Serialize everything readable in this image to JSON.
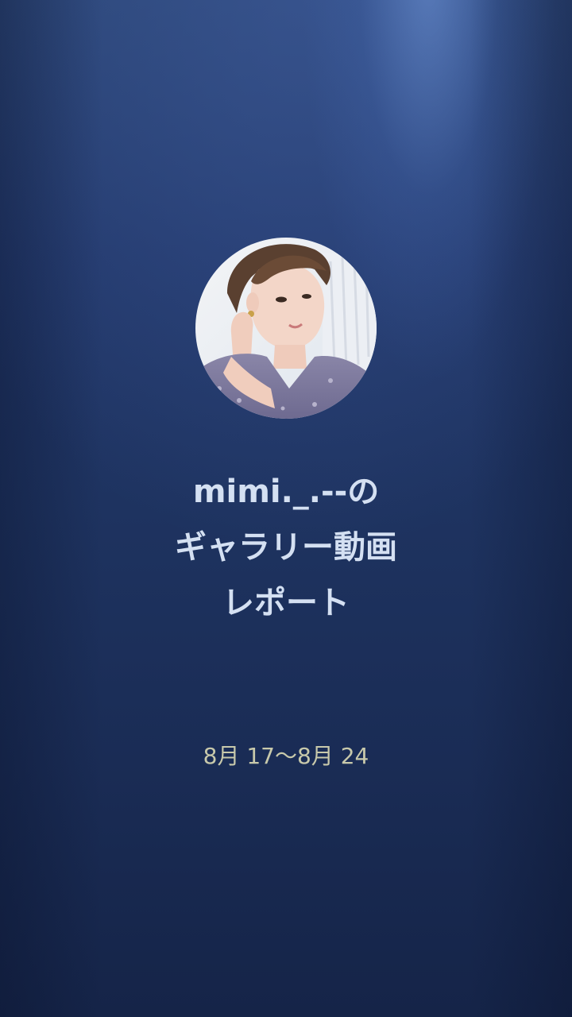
{
  "report": {
    "title_line1": "mimi._.--の",
    "title_line2": "ギャラリー動画",
    "title_line3": "レポート",
    "date_range": "8月 17〜8月 24"
  },
  "avatar": {
    "icon": "profile-photo",
    "description_color_bg": "#e6ecf2"
  },
  "colors": {
    "background_top": "#2a4474",
    "background_bottom": "#152448",
    "title_text": "#d4e0f2",
    "date_text": "#c8c9ab"
  }
}
